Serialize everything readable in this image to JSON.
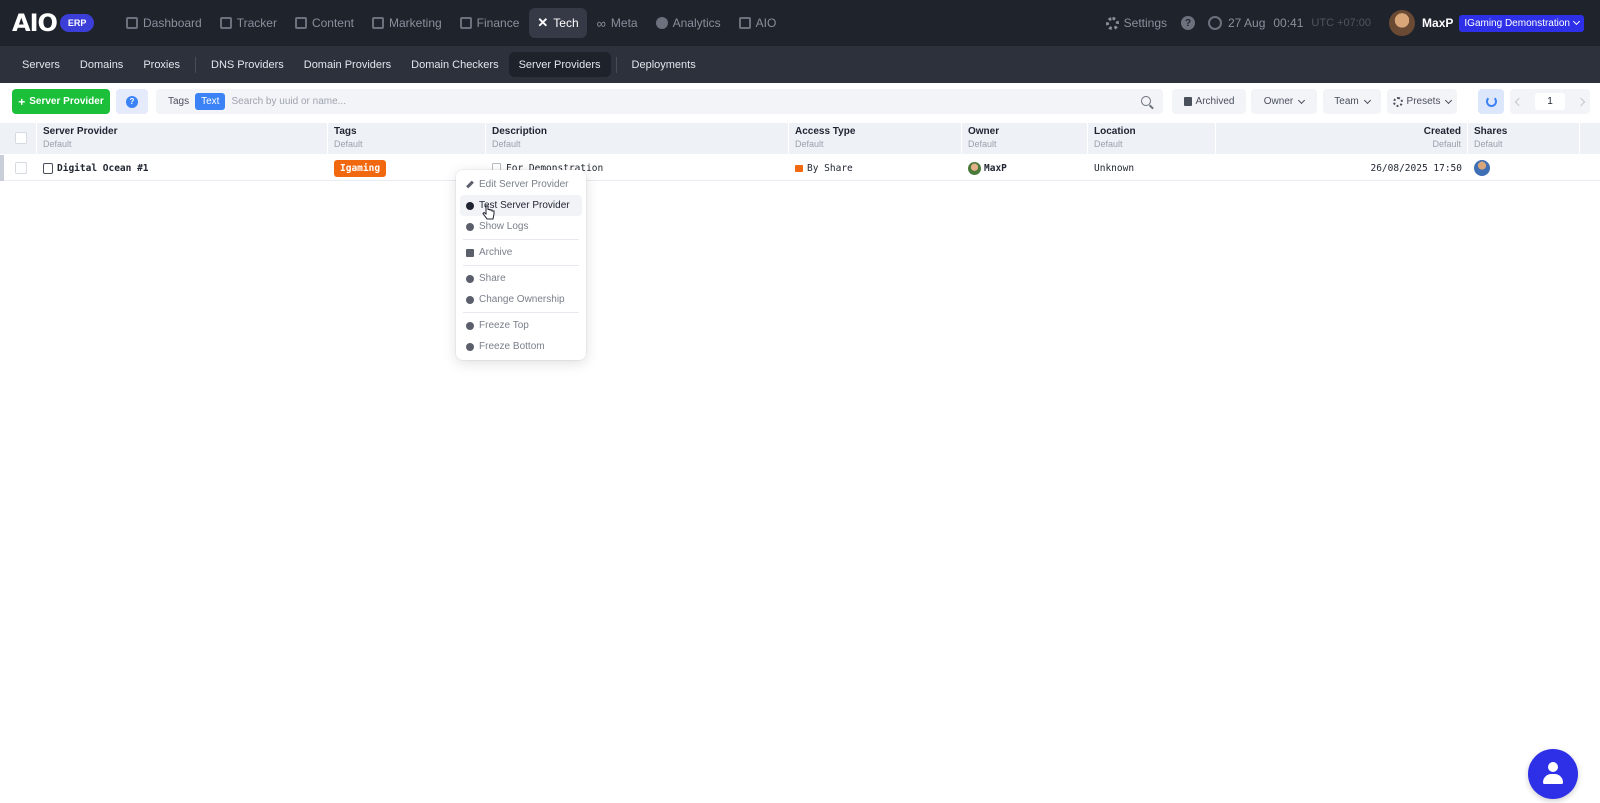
{
  "app": {
    "logo": "AIO",
    "badge": "ERP"
  },
  "mainnav": {
    "items": [
      {
        "label": "Dashboard"
      },
      {
        "label": "Tracker"
      },
      {
        "label": "Content"
      },
      {
        "label": "Marketing"
      },
      {
        "label": "Finance"
      },
      {
        "label": "Tech"
      },
      {
        "label": "Meta"
      },
      {
        "label": "Analytics"
      },
      {
        "label": "AIO"
      }
    ],
    "active": "Tech"
  },
  "header": {
    "settings_label": "Settings",
    "help": "?",
    "date": "27 Aug",
    "time": "00:41",
    "timezone": "UTC +07:00",
    "username": "MaxP",
    "workspace": "IGaming Demonstration"
  },
  "subnav": {
    "items": [
      {
        "label": "Servers"
      },
      {
        "label": "Domains"
      },
      {
        "label": "Proxies"
      },
      {
        "label": "DNS Providers"
      },
      {
        "label": "Domain Providers"
      },
      {
        "label": "Domain Checkers"
      },
      {
        "label": "Server Providers"
      },
      {
        "label": "Deployments"
      }
    ],
    "active": "Server Providers"
  },
  "toolbar": {
    "add_label": "Server Provider",
    "help": "?",
    "search_modes": {
      "tags": "Tags",
      "text": "Text"
    },
    "search_placeholder": "Search by uuid or name...",
    "archived_label": "Archived",
    "owner_label": "Owner",
    "team_label": "Team",
    "presets_label": "Presets",
    "page": "1"
  },
  "table": {
    "columns": [
      {
        "label": "Server Provider",
        "sub": "Default"
      },
      {
        "label": "Tags",
        "sub": "Default"
      },
      {
        "label": "Description",
        "sub": "Default"
      },
      {
        "label": "Access Type",
        "sub": "Default"
      },
      {
        "label": "Owner",
        "sub": "Default"
      },
      {
        "label": "Location",
        "sub": "Default"
      },
      {
        "label": "Created",
        "sub": "Default"
      },
      {
        "label": "Shares",
        "sub": "Default"
      }
    ],
    "rows": [
      {
        "name": "Digital Ocean #1",
        "tag": "Igaming",
        "description": "For Demonstration",
        "access": "By Share",
        "owner": "MaxP",
        "location": "Unknown",
        "created": "26/08/2025 17:50"
      }
    ]
  },
  "context_menu": {
    "items": [
      {
        "label": "Edit Server Provider"
      },
      {
        "label": "Test Server Provider"
      },
      {
        "label": "Show Logs"
      },
      {
        "label": "Archive"
      },
      {
        "label": "Share"
      },
      {
        "label": "Change Ownership"
      },
      {
        "label": "Freeze Top"
      },
      {
        "label": "Freeze Bottom"
      }
    ],
    "hovered": "Test Server Provider"
  },
  "colors": {
    "topbar": "#1f232c",
    "subnav": "#2c313c",
    "primary_add": "#1bbf3a",
    "accent": "#2d30e6",
    "tag_orange": "#f2680e"
  }
}
